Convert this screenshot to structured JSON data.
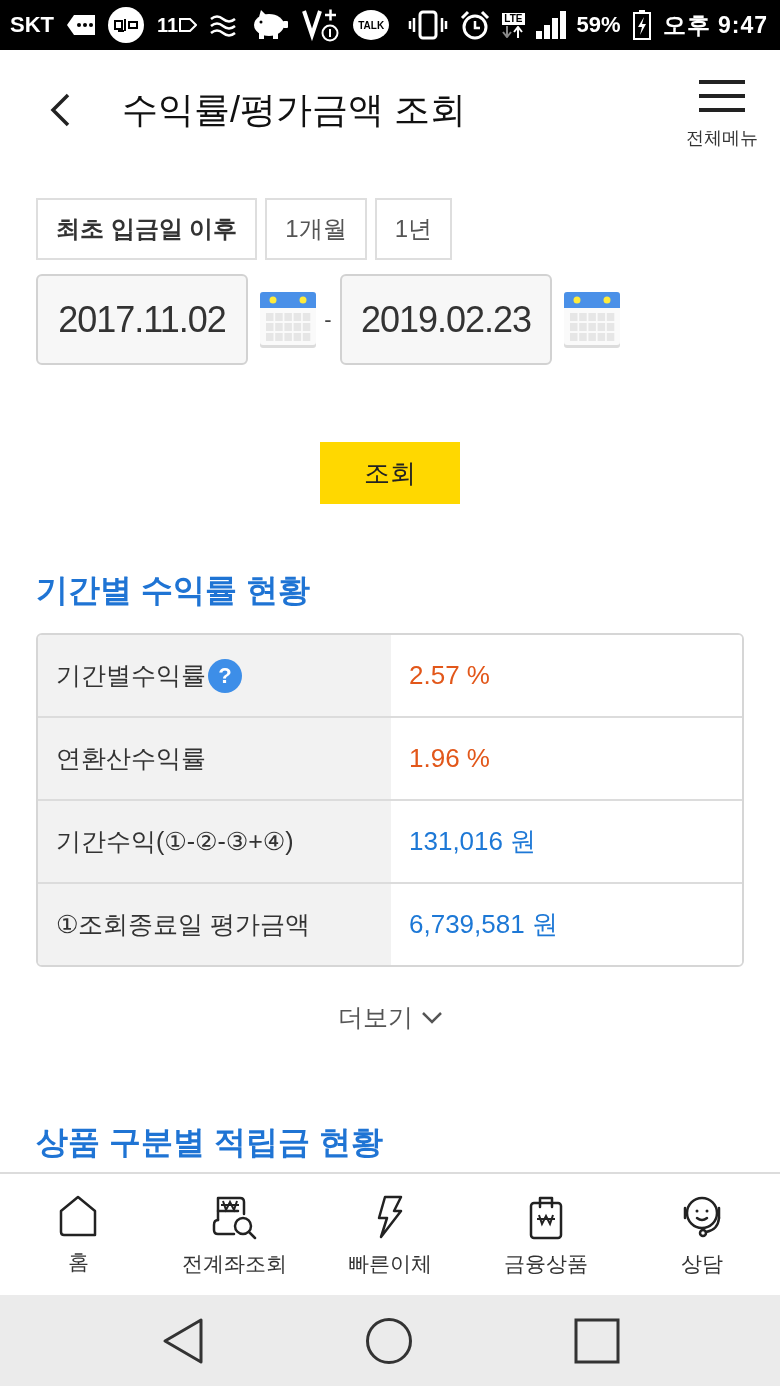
{
  "status_bar": {
    "carrier": "SKT",
    "notifications": [
      {
        "kind": "message"
      },
      {
        "kind": "circle_logo"
      },
      {
        "kind": "shopping",
        "label": "11"
      },
      {
        "kind": "waves"
      },
      {
        "kind": "piggy"
      },
      {
        "kind": "v_plus"
      },
      {
        "kind": "talk",
        "label": "TALK"
      }
    ],
    "network": "LTE",
    "battery": "59%",
    "time": "오후 9:47"
  },
  "header": {
    "title": "수익률/평가금액 조회",
    "menu_label": "전체메뉴"
  },
  "period_options": [
    {
      "label": "최초 입금일 이후",
      "selected": true
    },
    {
      "label": "1개월",
      "selected": false
    },
    {
      "label": "1년",
      "selected": false
    }
  ],
  "date_range": {
    "start": "2017.11.02",
    "separator": "-",
    "end": "2019.02.23"
  },
  "search_button": "조회",
  "sections": [
    {
      "title": "기간별 수익률 현황",
      "rows": [
        {
          "label": "기간별수익률",
          "help": "?",
          "value": "2.57 %",
          "color": "#e2571a"
        },
        {
          "label": "연환산수익률",
          "value": "1.96 %",
          "color": "#e2571a"
        },
        {
          "label": "기간수익(①-②-③+④)",
          "value": "131,016 원",
          "color": "#1d78d6"
        },
        {
          "label": "①조회종료일 평가금액",
          "value": "6,739,581 원",
          "color": "#1d78d6"
        }
      ],
      "more": "더보기"
    },
    {
      "title": "상품 구분별 적립금 현황"
    }
  ],
  "bottom_nav": [
    {
      "label": "홈",
      "kind": "home"
    },
    {
      "label": "전계좌조회",
      "kind": "accounts"
    },
    {
      "label": "빠른이체",
      "kind": "transfer"
    },
    {
      "label": "금융상품",
      "kind": "products"
    },
    {
      "label": "상담",
      "kind": "support"
    }
  ]
}
